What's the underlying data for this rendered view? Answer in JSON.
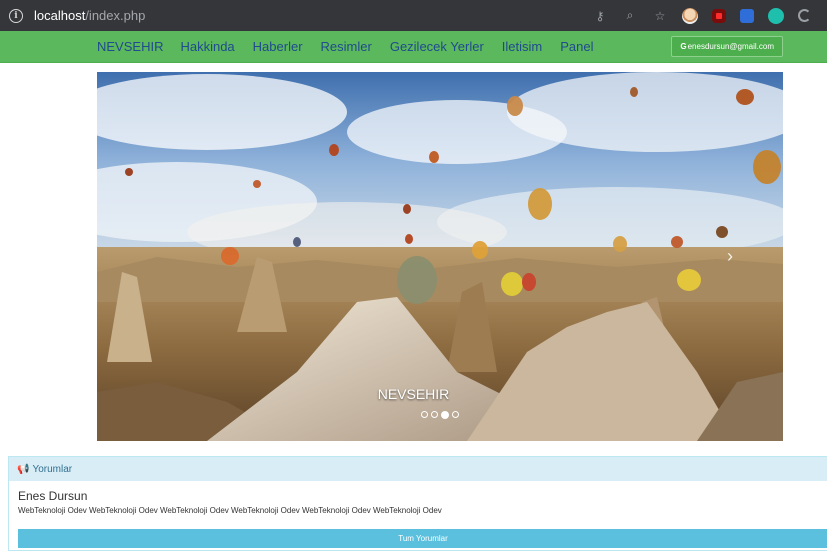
{
  "browser": {
    "url_host": "localhost",
    "url_path": "/index.php"
  },
  "navbar": {
    "brand": "NEVSEHIR",
    "links": [
      "Hakkinda",
      "Haberler",
      "Resimler",
      "Gezilecek Yerler",
      "Iletisim",
      "Panel"
    ],
    "user_email": "enesdursun@gmail.com"
  },
  "carousel": {
    "caption": "NEVSEHIR",
    "slide_count": 4,
    "active_index": 2
  },
  "comments": {
    "heading": "Yorumlar",
    "author": "Enes Dursun",
    "text": "WebTeknoloji Odev WebTeknoloji Odev WebTeknoloji Odev WebTeknoloji Odev WebTeknoloji Odev WebTeknoloji Odev",
    "all_button": "Tum Yorumlar"
  },
  "colors": {
    "navbar": "#5cb85c",
    "panel_heading": "#d9edf7",
    "button": "#5bc0de"
  }
}
